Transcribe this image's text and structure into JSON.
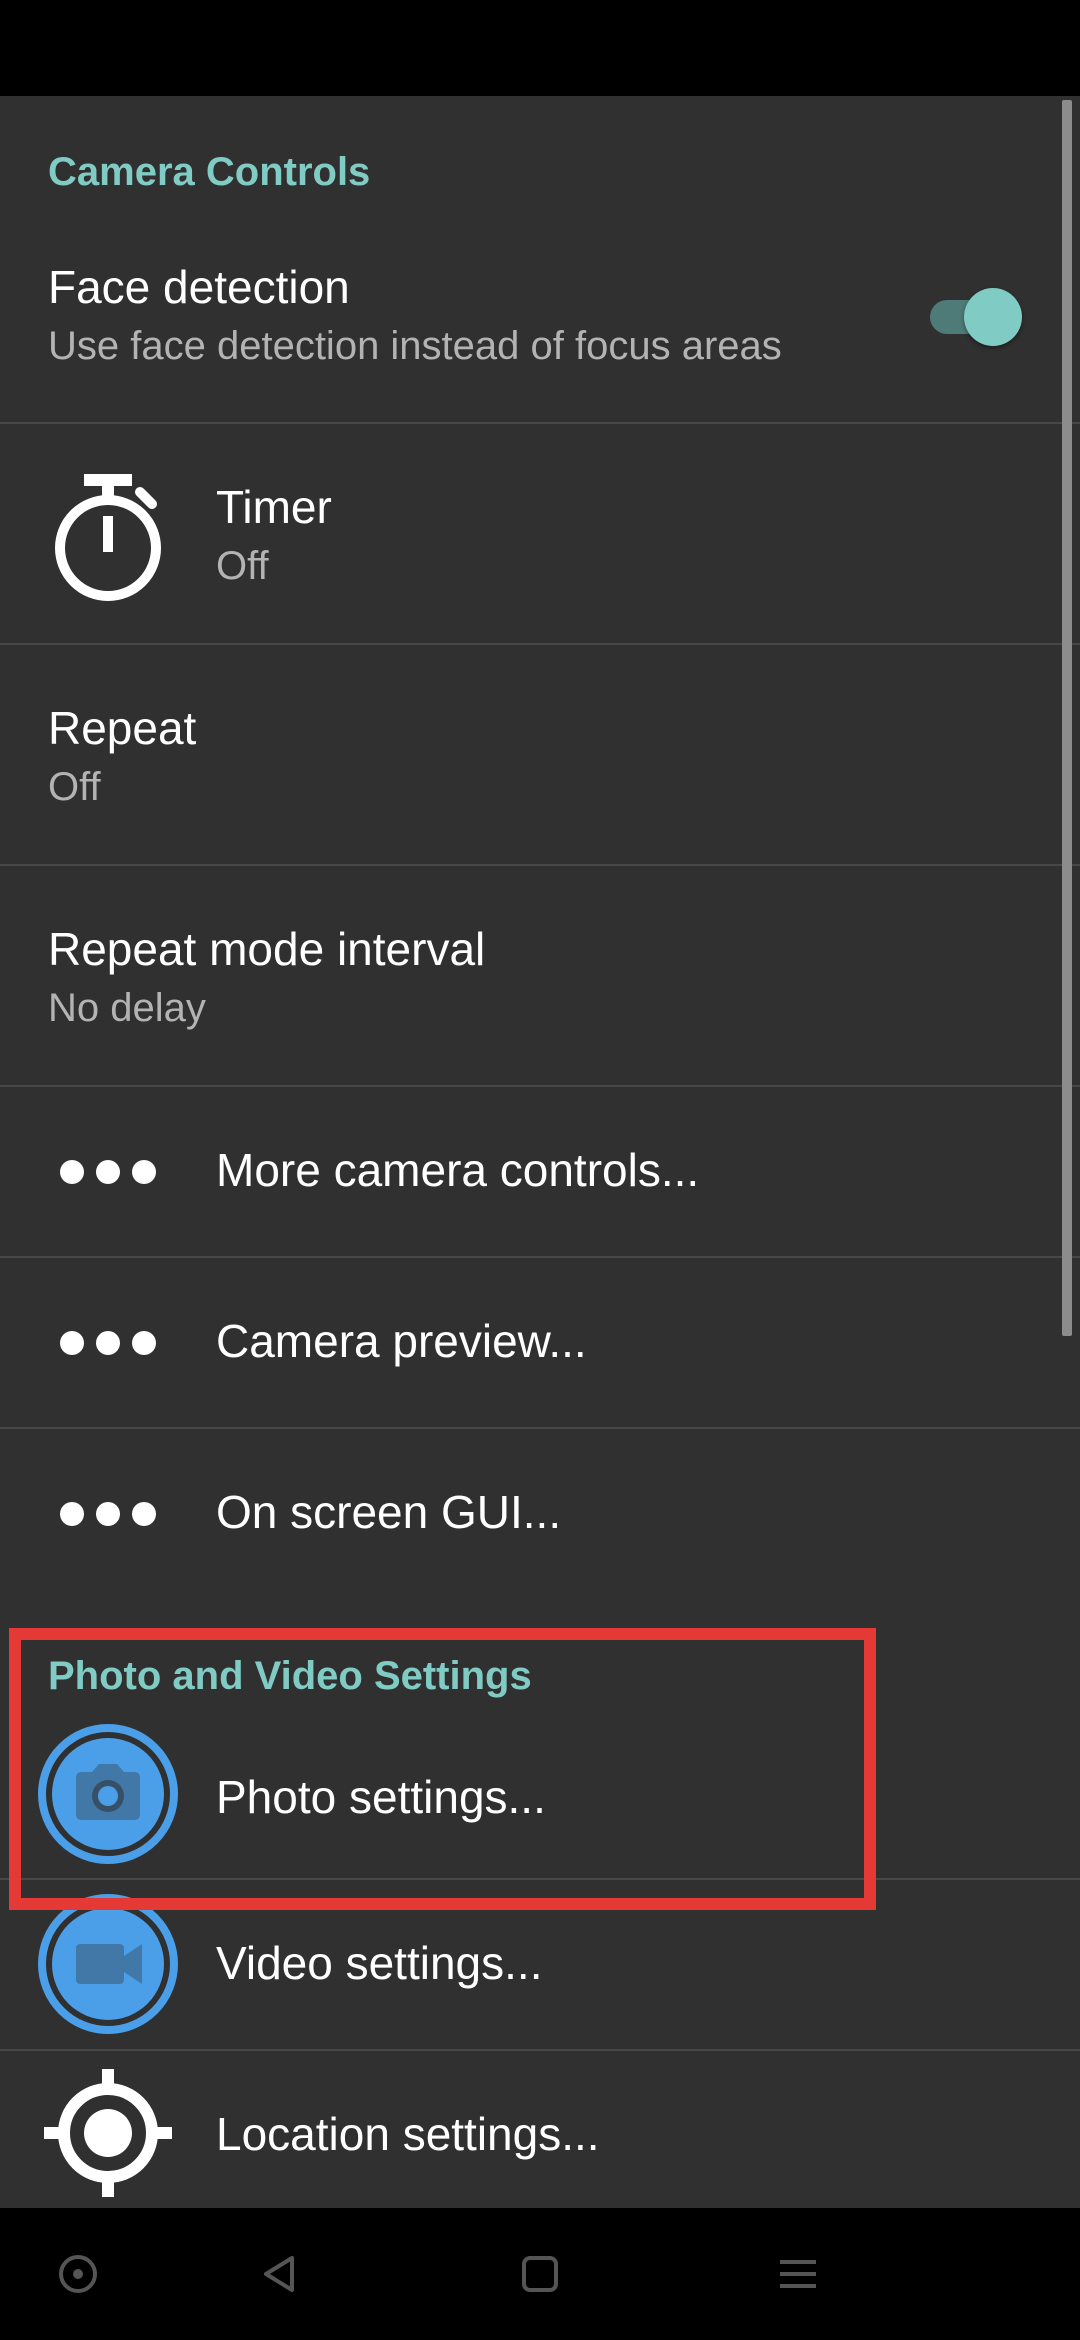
{
  "sections": [
    {
      "header": "Camera Controls"
    },
    {
      "header": "Photo and Video Settings"
    }
  ],
  "camera_controls": {
    "face_detection": {
      "title": "Face detection",
      "summary": "Use face detection instead of focus areas",
      "enabled": true
    },
    "timer": {
      "title": "Timer",
      "summary": "Off",
      "icon": "timer-icon"
    },
    "repeat": {
      "title": "Repeat",
      "summary": "Off"
    },
    "repeat_interval": {
      "title": "Repeat mode interval",
      "summary": "No delay"
    },
    "more_controls": {
      "title": "More camera controls...",
      "icon": "more-dots-icon"
    },
    "camera_preview": {
      "title": "Camera preview...",
      "icon": "more-dots-icon"
    },
    "on_screen_gui": {
      "title": "On screen GUI...",
      "icon": "more-dots-icon"
    }
  },
  "photo_video": {
    "photo_settings": {
      "title": "Photo settings...",
      "icon": "camera-icon"
    },
    "video_settings": {
      "title": "Video settings...",
      "icon": "video-camera-icon"
    },
    "location_settings": {
      "title": "Location settings...",
      "icon": "location-icon"
    }
  },
  "colors": {
    "accent": "#80cbc4",
    "background": "#303030",
    "highlight": "#e53935",
    "icon_blue": "#4a9fe8"
  }
}
